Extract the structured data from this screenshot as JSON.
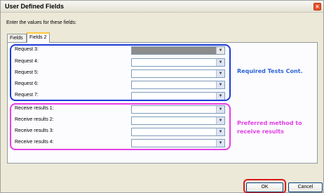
{
  "window": {
    "title": "User Defined Fields"
  },
  "instruction": "Enter the values for these fields:",
  "tabs": [
    {
      "label": "Fields 1",
      "active": false
    },
    {
      "label": "Fields 2",
      "active": true
    }
  ],
  "fields": [
    {
      "label": "Request 3:",
      "value": "",
      "disabled": true
    },
    {
      "label": "Request 4:",
      "value": ""
    },
    {
      "label": "Request 5:",
      "value": ""
    },
    {
      "label": "Request 6:",
      "value": ""
    },
    {
      "label": "Request 7:",
      "value": ""
    },
    {
      "label": "Receive results 1:",
      "value": ""
    },
    {
      "label": "Receive results 2:",
      "value": ""
    },
    {
      "label": "Receive results 3:",
      "value": ""
    },
    {
      "label": "Receive results 4:",
      "value": ""
    }
  ],
  "annotations": {
    "required": "Required Tests Cont.",
    "preferred_line1": "Preferred method to",
    "preferred_line2": "receive results",
    "colors": {
      "required": "#2b63d6",
      "preferred": "#e23ee6",
      "highlight": "#d81a1a"
    }
  },
  "buttons": {
    "ok": "OK",
    "cancel": "Cancel"
  },
  "icons": {
    "close": "close-icon",
    "dropdown": "chevron-down-icon"
  }
}
